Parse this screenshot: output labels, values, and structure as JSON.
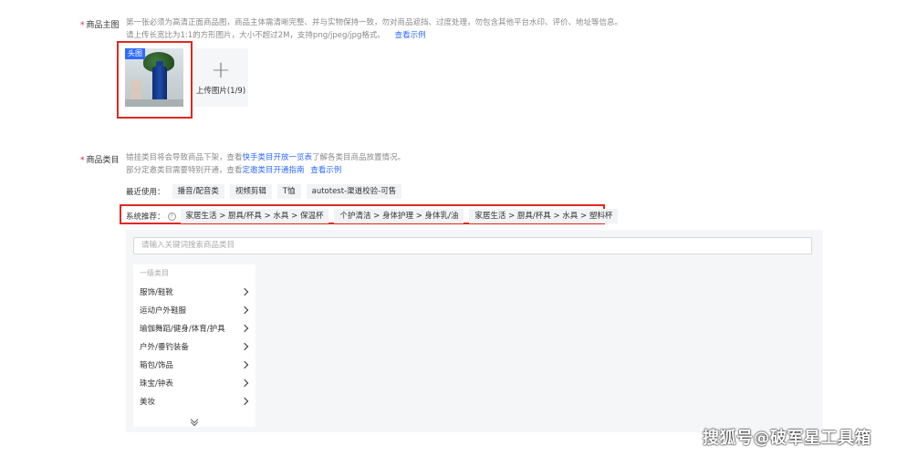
{
  "main_image": {
    "label": "商品主图",
    "required_mark": "*",
    "hint_line1": "第一张必须为高清正面商品图，商品主体需清晰完整、并与实物保持一致，勿对商品遮挡、过度处理，勿包含其他平台水印、评价、地址等信息。",
    "hint_line2": "请上传长宽比为1:1的方形图片，大小不超过2M，支持png/jpeg/jpg格式。",
    "example_link": "查看示例",
    "badge": "头图",
    "upload_label": "上传图片(1/9)"
  },
  "category": {
    "label": "商品类目",
    "required_mark": "*",
    "hint1_pre": "错挂类目将会导致商品下架，查看",
    "hint1_link": "快手类目开放一览表",
    "hint1_post": "了解各类目商品放置情况。",
    "hint2_pre": "部分定邀类目需要特别开通，查看",
    "hint2_link": "定邀类目开通指南",
    "hint2_link2": "查看示例",
    "recent_label": "最近使用：",
    "recent": [
      "播音/配音类",
      "视频剪辑",
      "T恤",
      "autotest-渠道校验-可售"
    ],
    "system_label": "系统推荐：",
    "help_icon_glyph": "?",
    "system": [
      "家居生活 > 厨具/杯具 > 水具 > 保温杯",
      "个护清洁 > 身体护理 > 身体乳/油",
      "家居生活 > 厨具/杯具 > 水具 > 塑料杯"
    ],
    "search_placeholder": "请输入关键词搜索商品类目",
    "level1_header": "一级类目",
    "level1": [
      "服饰/鞋靴",
      "运动户外鞋服",
      "瑜伽舞蹈/健身/体育/护具",
      "户外/垂钓装备",
      "箱包/饰品",
      "珠宝/钟表",
      "美妆"
    ]
  },
  "watermark": "搜狐号@破军星工具箱",
  "colors": {
    "accent": "#2f6bff",
    "highlight_border": "#e0291f",
    "required": "#e02020"
  }
}
